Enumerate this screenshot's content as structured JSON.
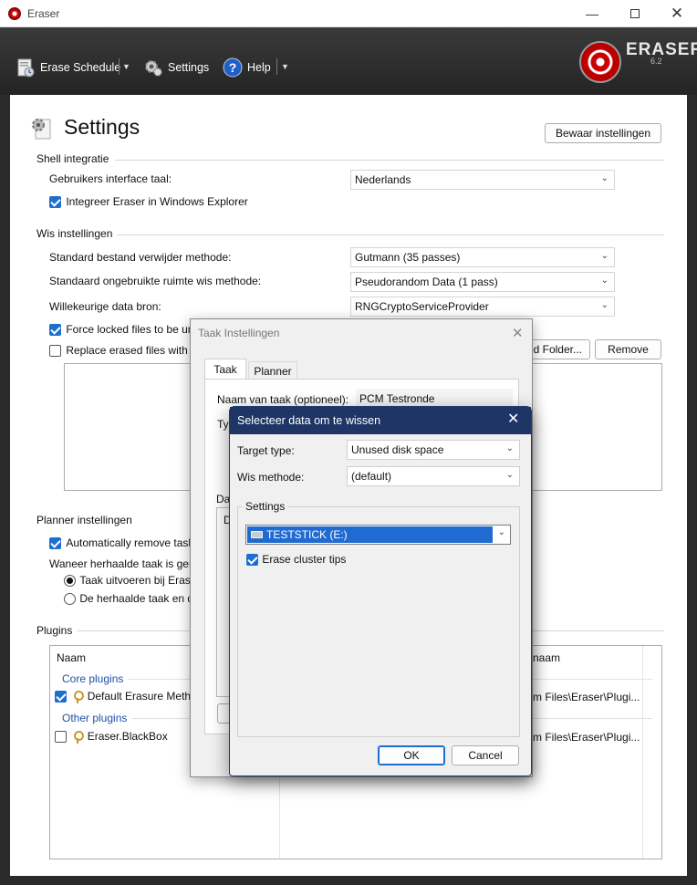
{
  "window": {
    "title": "Eraser"
  },
  "toolbar": {
    "erase_schedule": "Erase Schedule",
    "settings": "Settings",
    "help": "Help",
    "logo_text": "ERASER",
    "logo_version": "6.2"
  },
  "settings": {
    "title": "Settings",
    "save_button": "Bewaar instellingen",
    "shell": {
      "heading": "Shell integratie",
      "language_label": "Gebruikers interface taal:",
      "language_value": "Nederlands",
      "integrate_label": "Integreer Eraser in Windows Explorer"
    },
    "erase": {
      "heading": "Wis instellingen",
      "file_method_label": "Standard bestand verwijder methode:",
      "file_method_value": "Gutmann (35 passes)",
      "space_method_label": "Standaard ongebruikte ruimte wis methode:",
      "space_method_value": "Pseudorandom Data (1 pass)",
      "random_source_label": "Willekeurige data bron:",
      "random_source_value": "RNGCryptoServiceProvider",
      "force_locked_label": "Force locked files to be un",
      "replace_erased_label": "Replace erased files with th",
      "add_folder_button": "d Folder...",
      "remove_button": "Remove"
    },
    "scheduler": {
      "heading": "Planner instellingen",
      "auto_remove_label": "Automatically remove task",
      "recurring_label": "Waneer herhaalde taak is gem",
      "radio_run_label": "Taak uitvoeren bij Erase",
      "radio_skip_label": "De herhaalde taak en do"
    },
    "plugins": {
      "heading": "Plugins",
      "col_name": "Naam",
      "col_path": "naam",
      "core_group": "Core plugins",
      "core_item": "Default Erasure Metho",
      "core_path": "m Files\\Eraser\\Plugi...",
      "other_group": "Other plugins",
      "other_item": "Eraser.BlackBox",
      "other_path": "m Files\\Eraser\\Plugi..."
    }
  },
  "task_dialog": {
    "title": "Taak Instellingen",
    "tab_task": "Taak",
    "tab_scheduler": "Planner",
    "name_label": "Naam van taak (optioneel):",
    "name_value": "PCM Testronde",
    "type_partial": "Typ",
    "data_partial": "Da",
    "list_partial": "D"
  },
  "select_dialog": {
    "title": "Selecteer data om te wissen",
    "target_label": "Target type:",
    "target_value": "Unused disk space",
    "method_label": "Wis methode:",
    "method_value": "(default)",
    "settings_group": "Settings",
    "drive_value": "TESTSTICK (E:)",
    "cluster_tips_label": "Erase cluster tips",
    "ok": "OK",
    "cancel": "Cancel"
  }
}
